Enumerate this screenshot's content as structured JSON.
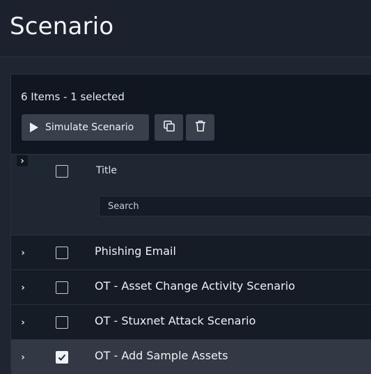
{
  "header": {
    "title": "Scenario"
  },
  "toolbar": {
    "items_count": "6 Items - 1 selected",
    "simulate_label": "Simulate Scenario",
    "copy_icon": "copy-icon",
    "delete_icon": "trash-icon"
  },
  "table": {
    "column_title": "Title",
    "search_placeholder": "Search",
    "rows": [
      {
        "title": "Phishing Email",
        "selected": false
      },
      {
        "title": "OT - Asset Change Activity Scenario",
        "selected": false
      },
      {
        "title": "OT - Stuxnet Attack Scenario",
        "selected": false
      },
      {
        "title": "OT - Add Sample Assets",
        "selected": true
      }
    ]
  },
  "colors": {
    "background": "#1f2631",
    "panel": "#111720",
    "button": "#38404c",
    "selected_row": "#323945"
  }
}
